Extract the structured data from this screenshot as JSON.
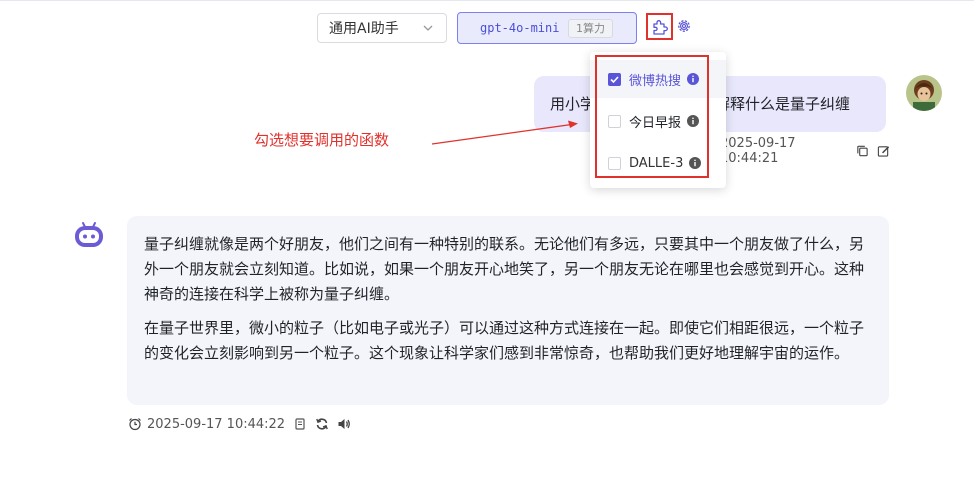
{
  "toolbar": {
    "assistant_select_value": "通用AI助手",
    "model_name": "gpt-4o-mini",
    "model_cost": "1算力",
    "plugin_icon": "puzzle-icon",
    "settings_icon": "gear-icon"
  },
  "user_message": {
    "text": "用小学生能听得懂的话，解释什么是量子纠缠",
    "timestamp": "2025-09-17 10:44:21",
    "actions": [
      "copy-icon",
      "edit-icon"
    ]
  },
  "function_dropdown": {
    "items": [
      {
        "label": "微博热搜",
        "checked": true
      },
      {
        "label": "今日早报",
        "checked": false
      },
      {
        "label": "DALLE-3",
        "checked": false
      }
    ],
    "accent": "#5a55d8"
  },
  "annotation": {
    "text": "勾选想要调用的函数",
    "color": "#e0322d"
  },
  "bot_message": {
    "paragraphs": [
      "量子纠缠就像是两个好朋友，他们之间有一种特别的联系。无论他们有多远，只要其中一个朋友做了什么，另外一个朋友就会立刻知道。比如说，如果一个朋友开心地笑了，另一个朋友无论在哪里也会感觉到开心。这种神奇的连接在科学上被称为量子纠缠。",
      "在量子世界里，微小的粒子（比如电子或光子）可以通过这种方式连接在一起。即使它们相距很远，一个粒子的变化会立刻影响到另一个粒子。这个现象让科学家们感到非常惊奇，也帮助我们更好地理解宇宙的运作。"
    ],
    "timestamp": "2025-09-17 10:44:22",
    "actions": [
      "copy-icon",
      "regenerate-icon",
      "speaker-icon"
    ]
  }
}
